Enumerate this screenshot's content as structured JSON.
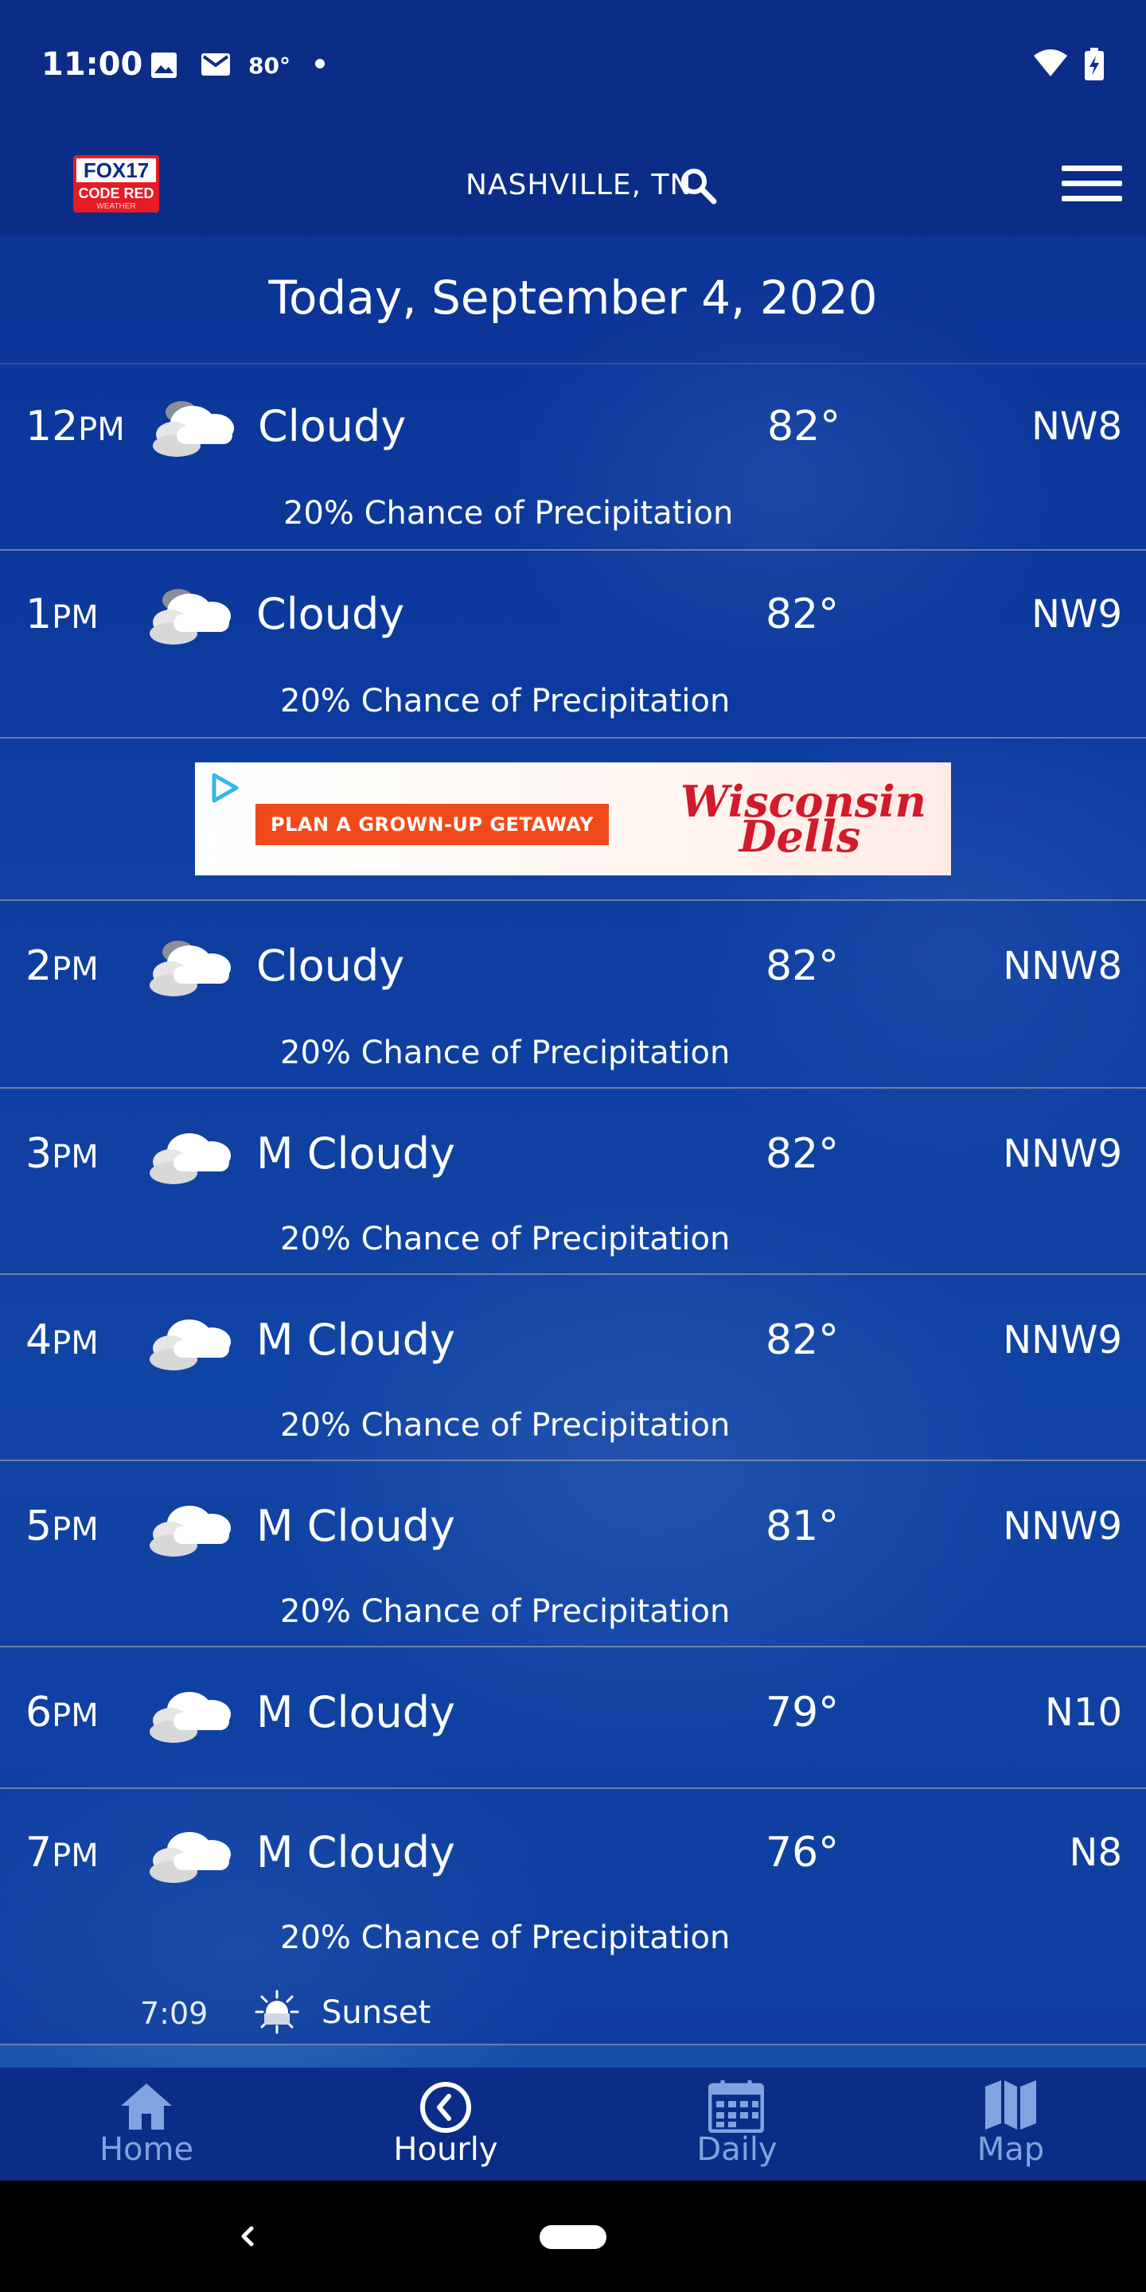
{
  "status_bar": {
    "time": "11:00",
    "temp": "80°",
    "icons": [
      "image-icon",
      "mail-icon",
      "wifi-icon",
      "battery-charging-icon"
    ]
  },
  "header": {
    "logo_text": "FOX17",
    "logo_sub": "CODE RED",
    "logo_sub2": "WEATHER",
    "location": "NASHVILLE, TN"
  },
  "date_title": "Today, September 4, 2020",
  "hours": [
    {
      "hour": "12",
      "ampm": "PM",
      "condition": "Cloudy",
      "temp": "82°",
      "wind": "NW8",
      "precip": "20% Chance of Precipitation",
      "icon": "cloudy-icon"
    },
    {
      "hour": "1",
      "ampm": "PM",
      "condition": "Cloudy",
      "temp": "82°",
      "wind": "NW9",
      "precip": "20% Chance of Precipitation",
      "icon": "cloudy-icon"
    },
    {
      "hour": "2",
      "ampm": "PM",
      "condition": "Cloudy",
      "temp": "82°",
      "wind": "NNW8",
      "precip": "20% Chance of Precipitation",
      "icon": "cloudy-icon"
    },
    {
      "hour": "3",
      "ampm": "PM",
      "condition": "M Cloudy",
      "temp": "82°",
      "wind": "NNW9",
      "precip": "20% Chance of Precipitation",
      "icon": "mostly-cloudy-icon"
    },
    {
      "hour": "4",
      "ampm": "PM",
      "condition": "M Cloudy",
      "temp": "82°",
      "wind": "NNW9",
      "precip": "20% Chance of Precipitation",
      "icon": "mostly-cloudy-icon"
    },
    {
      "hour": "5",
      "ampm": "PM",
      "condition": "M Cloudy",
      "temp": "81°",
      "wind": "NNW9",
      "precip": "20% Chance of Precipitation",
      "icon": "mostly-cloudy-icon"
    },
    {
      "hour": "6",
      "ampm": "PM",
      "condition": "M Cloudy",
      "temp": "79°",
      "wind": "N10",
      "precip": "",
      "icon": "mostly-cloudy-icon"
    },
    {
      "hour": "7",
      "ampm": "PM",
      "condition": "M Cloudy",
      "temp": "76°",
      "wind": "N8",
      "precip": "20% Chance of Precipitation",
      "icon": "mostly-cloudy-icon"
    }
  ],
  "ad": {
    "cta": "PLAN A GROWN-UP GETAWAY",
    "brand_line1": "Wisconsin",
    "brand_line2": "Dells"
  },
  "sunset": {
    "time": "7:09",
    "label": "Sunset"
  },
  "nav": [
    {
      "label": "Home",
      "icon": "home-icon",
      "active": false
    },
    {
      "label": "Hourly",
      "icon": "clock-icon",
      "active": true
    },
    {
      "label": "Daily",
      "icon": "calendar-icon",
      "active": false
    },
    {
      "label": "Map",
      "icon": "map-icon",
      "active": false
    }
  ],
  "colors": {
    "header_bg": "#0b2d87",
    "nav_inactive": "#7fa4e0",
    "ad_accent": "#f04a1a",
    "brand_red": "#d21a2a"
  }
}
